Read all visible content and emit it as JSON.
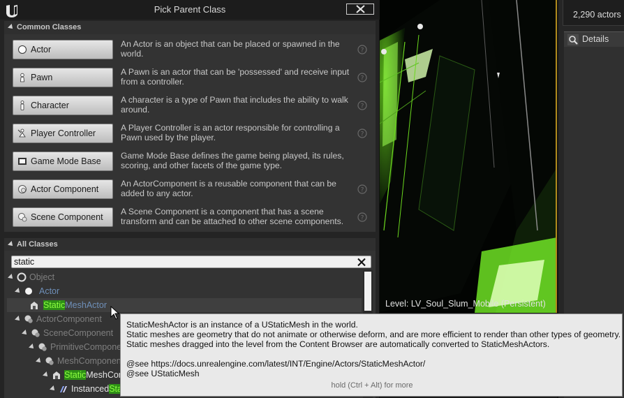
{
  "dialog": {
    "title": "Pick Parent Class"
  },
  "common_classes": {
    "header": "Common Classes",
    "items": [
      {
        "label": "Actor",
        "icon": "actor-sphere-icon",
        "description": "An Actor is an object that can be placed or spawned in the world."
      },
      {
        "label": "Pawn",
        "icon": "pawn-icon",
        "description": "A Pawn is an actor that can be 'possessed' and receive input from a controller."
      },
      {
        "label": "Character",
        "icon": "character-icon",
        "description": "A character is a type of Pawn that includes the ability to walk around."
      },
      {
        "label": "Player Controller",
        "icon": "player-controller-icon",
        "description": "A Player Controller is an actor responsible for controlling a Pawn used by the player."
      },
      {
        "label": "Game Mode Base",
        "icon": "game-mode-icon",
        "description": "Game Mode Base defines the game being played, its rules, scoring, and other facets of the game type."
      },
      {
        "label": "Actor Component",
        "icon": "actor-component-icon",
        "description": "An ActorComponent is a reusable component that can be added to any actor."
      },
      {
        "label": "Scene Component",
        "icon": "scene-component-icon",
        "description": "A Scene Component is a component that has a scene transform and can be attached to other scene components."
      }
    ]
  },
  "all_classes": {
    "header": "All Classes",
    "search_value": "static",
    "tree": [
      {
        "pre": "",
        "hl": "",
        "post": "Object",
        "style": "dim",
        "icon": "object-icon"
      },
      {
        "pre": "",
        "hl": "",
        "post": "Actor",
        "style": "blue",
        "icon": "actor-sphere-icon"
      },
      {
        "pre": "",
        "hl": "Static",
        "post": "MeshActor",
        "style": "blue",
        "icon": "static-mesh-actor-icon"
      },
      {
        "pre": "",
        "hl": "",
        "post": "ActorComponent",
        "style": "dim",
        "icon": "actor-component-icon"
      },
      {
        "pre": "",
        "hl": "",
        "post": "SceneComponent",
        "style": "dim",
        "icon": "scene-component-icon"
      },
      {
        "pre": "",
        "hl": "",
        "post": "PrimitiveCompone",
        "style": "dim",
        "icon": "primitive-component-icon"
      },
      {
        "pre": "",
        "hl": "",
        "post": "MeshComponen",
        "style": "dim",
        "icon": "mesh-component-icon"
      },
      {
        "pre": "",
        "hl": "Static",
        "post": "MeshCom",
        "style": "white",
        "icon": "static-mesh-component-icon"
      },
      {
        "pre": "Instanced",
        "hl": "Sta",
        "post": "",
        "style": "white",
        "icon": "instanced-mesh-icon"
      }
    ]
  },
  "tooltip": {
    "lines": [
      "StaticMeshActor is an instance of a UStaticMesh in the world.",
      "Static meshes are geometry that do not animate or otherwise deform, and are more efficient to render than other types of geometry.",
      "Static meshes dragged into the level from the Content Browser are automatically converted to StaticMeshActors.",
      "@see https://docs.unrealengine.com/latest/INT/Engine/Actors/StaticMeshActor/",
      "@see UStaticMesh"
    ],
    "hint": "hold (Ctrl + Alt) for more"
  },
  "viewport": {
    "level_label": "Level:  LV_Soul_Slum_Mobile (Persistent)"
  },
  "right_panel": {
    "actor_count": "2,290 actors",
    "details_tab": "Details"
  },
  "colors": {
    "search_highlight_bg": "#2e8f16",
    "search_highlight_text": "#8dff40",
    "tree_blue": "#6e8fb8",
    "viewport_green": "#7dff2a",
    "border_gold": "#b08a1c"
  }
}
